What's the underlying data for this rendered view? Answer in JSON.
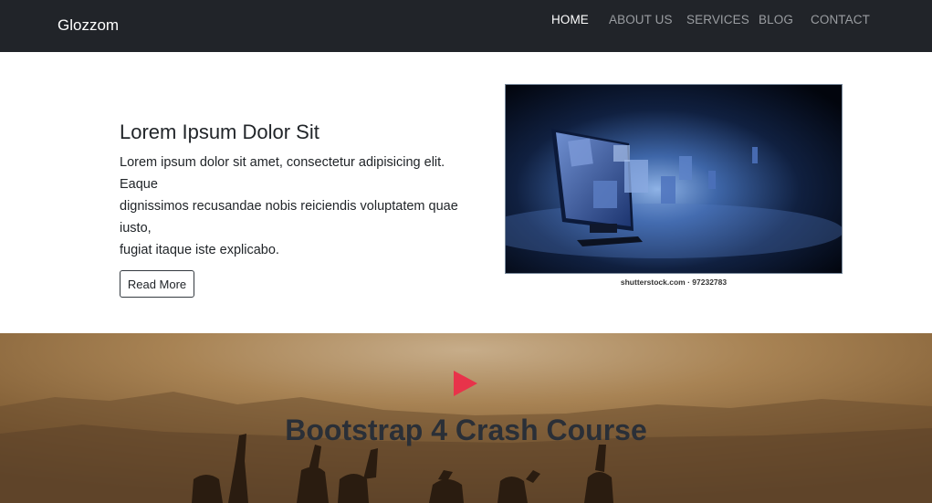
{
  "navbar": {
    "brand": "Glozzom",
    "links": [
      {
        "label": "HOME",
        "active": true
      },
      {
        "label": "ABOUT US",
        "active": false
      },
      {
        "label": "SERVICES",
        "active": false
      },
      {
        "label": "BLOG",
        "active": false
      },
      {
        "label": "CONTACT",
        "active": false
      }
    ]
  },
  "showcase": {
    "title": "Lorem Ipsum Dolor Sit",
    "text_lines": [
      "Lorem ipsum dolor sit amet, consectetur adipisicing elit. Eaque",
      "dignissimos recusandae nobis reiciendis voluptatem quae iusto,",
      "fugiat itaque iste explicabo."
    ],
    "button_label": "Read More",
    "image_caption": "shutterstock.com · 97232783"
  },
  "video": {
    "title": "Bootstrap 4 Crash Course",
    "play_icon": "play-icon"
  },
  "colors": {
    "navbar_bg": "#212429",
    "nav_active": "#ffffff",
    "nav_inactive": "#9a9da1",
    "play_accent": "#e8334a"
  }
}
